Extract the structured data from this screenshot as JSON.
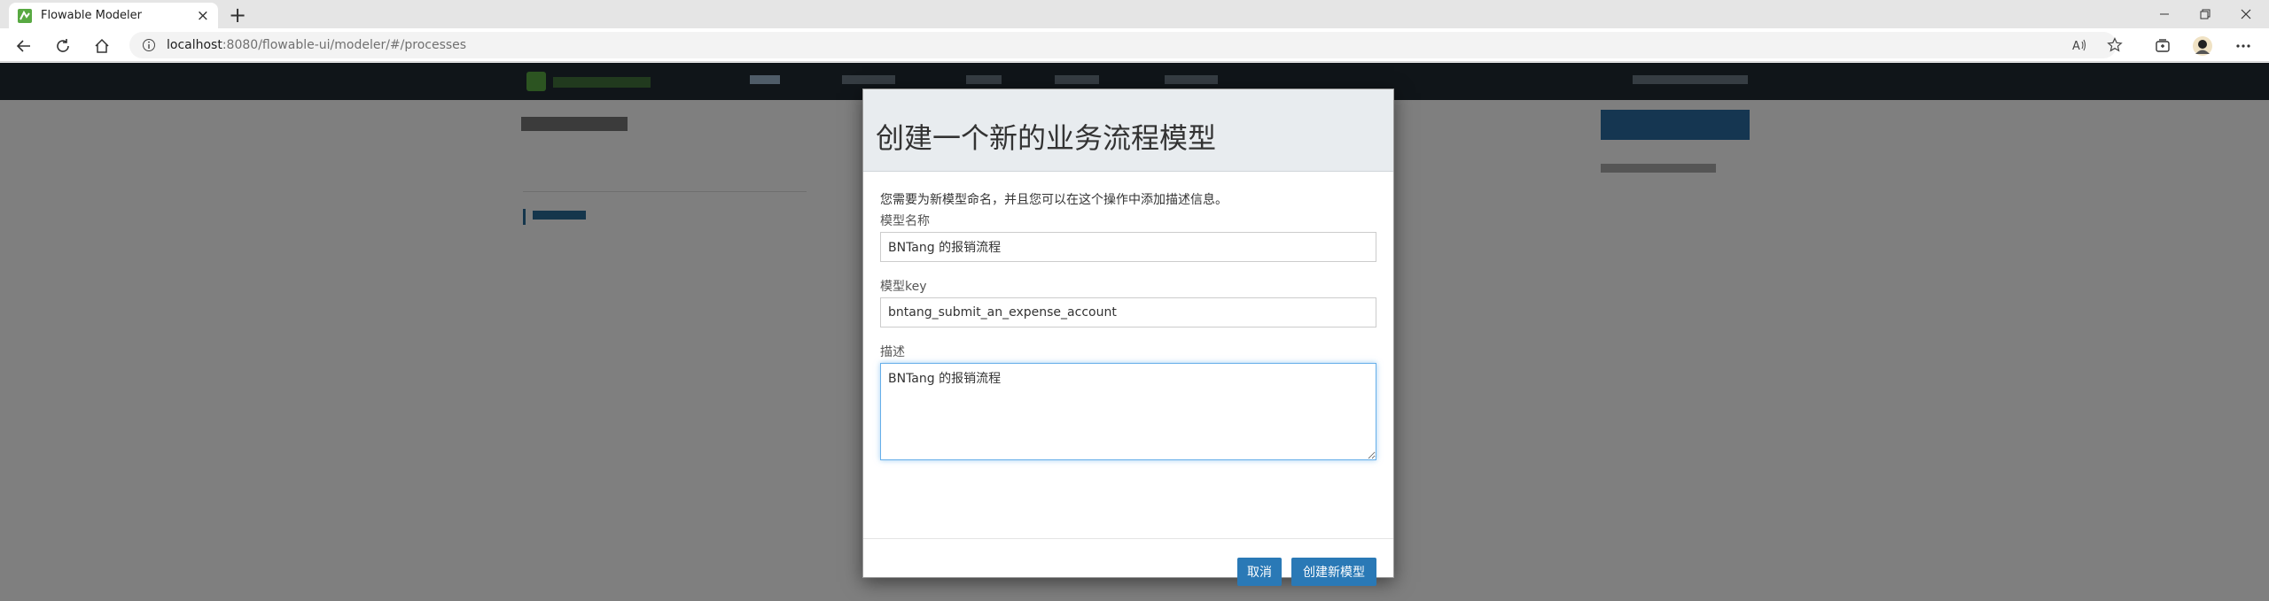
{
  "browser": {
    "tab_title": "Flowable Modeler",
    "new_tab_symbol": "+",
    "close_symbol": "×",
    "url_host": "localhost",
    "url_rest": ":8080/flowable-ui/modeler/#/processes"
  },
  "icons": {
    "back": "back-arrow-icon",
    "reload": "reload-icon",
    "home": "home-icon",
    "info": "info-icon",
    "read_aloud": "read-aloud-icon",
    "favorite": "star-icon",
    "collections": "collections-icon",
    "profile": "profile-avatar-icon",
    "more": "more-icon"
  },
  "colors": {
    "primary_button": "#2a79b6",
    "modal_header_bg": "#e8ecef",
    "app_header_bg": "#212a33"
  },
  "modal": {
    "title": "创建一个新的业务流程模型",
    "intro": "您需要为新模型命名，并且您可以在这个操作中添加描述信息。",
    "fields": {
      "name_label": "模型名称",
      "name_value": "BNTang 的报销流程",
      "key_label": "模型key",
      "key_value": "bntang_submit_an_expense_account",
      "desc_label": "描述",
      "desc_value": "BNTang 的报销流程"
    },
    "cancel_label": "取消",
    "create_label": "创建新模型"
  }
}
